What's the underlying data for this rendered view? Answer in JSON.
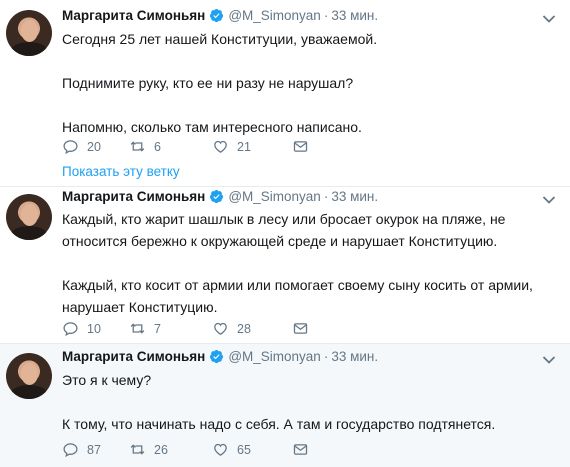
{
  "tweets": [
    {
      "author": "Маргарита Симоньян",
      "handle": "@M_Simonyan",
      "dot": "·",
      "time": "33 мин.",
      "lines": [
        "Сегодня 25 лет нашей Конституции, уважаемой.",
        "Поднимите руку, кто ее ни разу не нарушал?",
        "Напомню, сколько там интересного написано."
      ],
      "replies": "20",
      "retweets": "6",
      "likes": "21",
      "show_thread": "Показать эту ветку"
    },
    {
      "author": "Маргарита Симоньян",
      "handle": "@M_Simonyan",
      "dot": "·",
      "time": "33 мин.",
      "lines": [
        "Каждый, кто жарит шашлык в лесу или бросает окурок на пляже, не относится бережно к окружающей среде и нарушает Конституцию.",
        "Каждый, кто косит от армии или помогает своему сыну косить от армии, нарушает Конституцию."
      ],
      "replies": "10",
      "retweets": "7",
      "likes": "28"
    },
    {
      "author": "Маргарита Симоньян",
      "handle": "@M_Simonyan",
      "dot": "·",
      "time": "33 мин.",
      "lines": [
        "Это я к чему?",
        "К тому, что начинать надо с себя. А там и государство подтянется."
      ],
      "replies": "87",
      "retweets": "26",
      "likes": "65"
    }
  ],
  "colors": {
    "accent": "#1da1f2",
    "muted": "#657786",
    "highlight_bg": "#f5f8fa",
    "divider": "#e6ecf0"
  },
  "icons": [
    "reply-icon",
    "retweet-icon",
    "like-icon",
    "dm-icon",
    "verified-badge-icon",
    "chevron-down-icon"
  ]
}
